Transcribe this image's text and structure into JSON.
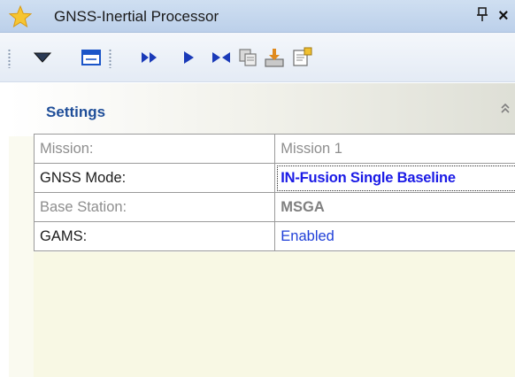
{
  "window": {
    "title": "GNSS-Inertial Processor",
    "pin_glyph": "ᅮ",
    "close_glyph": "×"
  },
  "toolbar": {
    "buttons": [
      {
        "name": "dropdown-arrow-icon"
      },
      {
        "name": "window-toggle-icon"
      },
      {
        "name": "fast-forward-icon"
      },
      {
        "name": "play-icon"
      },
      {
        "name": "process-both-directions-icon"
      },
      {
        "name": "copy-icon"
      },
      {
        "name": "export-icon"
      },
      {
        "name": "properties-icon"
      }
    ]
  },
  "settings": {
    "title": "Settings",
    "rows": [
      {
        "label": "Mission:",
        "value": "Mission 1"
      },
      {
        "label": "GNSS Mode:",
        "value": "IN-Fusion Single Baseline"
      },
      {
        "label": "Base Station:",
        "value": "MSGA"
      },
      {
        "label": "GAMS:",
        "value": "Enabled"
      }
    ]
  },
  "colors": {
    "title_bar": "#c4d6ed",
    "settings_title": "#1f4e99",
    "value_blue": "#1a1ae6",
    "panel_body": "#f8f8e4"
  }
}
